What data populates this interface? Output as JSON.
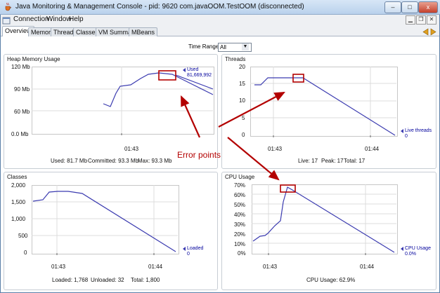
{
  "window": {
    "title": "Java Monitoring & Management Console - pid: 9620 com.javaOOM.TestOOM (disconnected)",
    "min": "–",
    "max": "□",
    "close": "x"
  },
  "menu": [
    "Connection",
    "Window",
    "Help"
  ],
  "tabs": [
    "Overview",
    "Memory",
    "Threads",
    "Classes",
    "VM Summary",
    "MBeans"
  ],
  "time_range": {
    "label": "Time Range:",
    "value": "All"
  },
  "annotation": {
    "text": "Error points",
    "color": "#b30000"
  },
  "chart_data": [
    {
      "type": "line",
      "title": "Heap Memory Usage",
      "y_ticks": [
        "120 Mb",
        "90 Mb",
        "60 Mb",
        "0.0 Mb"
      ],
      "x_ticks": [
        "01:43"
      ],
      "series": [
        {
          "name": "Used",
          "value": "81,669,992",
          "color": "#3b3bb0"
        }
      ],
      "stats": {
        "used": "Used: 81.7 Mb",
        "committed": "Committed: 93.3 Mb",
        "max": "Max: 93.3 Mb"
      }
    },
    {
      "type": "line",
      "title": "Threads",
      "y_ticks": [
        "20",
        "15",
        "10",
        "5",
        "0"
      ],
      "x_ticks": [
        "01:43",
        "01:44"
      ],
      "series": [
        {
          "name": "Live threads",
          "value": "0",
          "color": "#3b3bb0"
        }
      ],
      "stats": {
        "live": "Live: 17",
        "peak": "Peak: 17",
        "total": "Total: 17"
      }
    },
    {
      "type": "line",
      "title": "Classes",
      "y_ticks": [
        "2,000",
        "1,500",
        "1,000",
        "500",
        "0"
      ],
      "x_ticks": [
        "01:43",
        "01:44"
      ],
      "series": [
        {
          "name": "Loaded",
          "value": "0",
          "color": "#3b3bb0"
        }
      ],
      "stats": {
        "loaded": "Loaded: 1,768",
        "unloaded": "Unloaded: 32",
        "total": "Total: 1,800"
      }
    },
    {
      "type": "line",
      "title": "CPU Usage",
      "y_ticks": [
        "70%",
        "60%",
        "50%",
        "40%",
        "30%",
        "20%",
        "10%",
        "0%"
      ],
      "x_ticks": [
        "01:43",
        "01:44"
      ],
      "series": [
        {
          "name": "CPU Usage",
          "value": "0.0%",
          "color": "#3b3bb0"
        }
      ],
      "stats": {
        "cpu": "CPU Usage: 62.9%"
      }
    }
  ]
}
